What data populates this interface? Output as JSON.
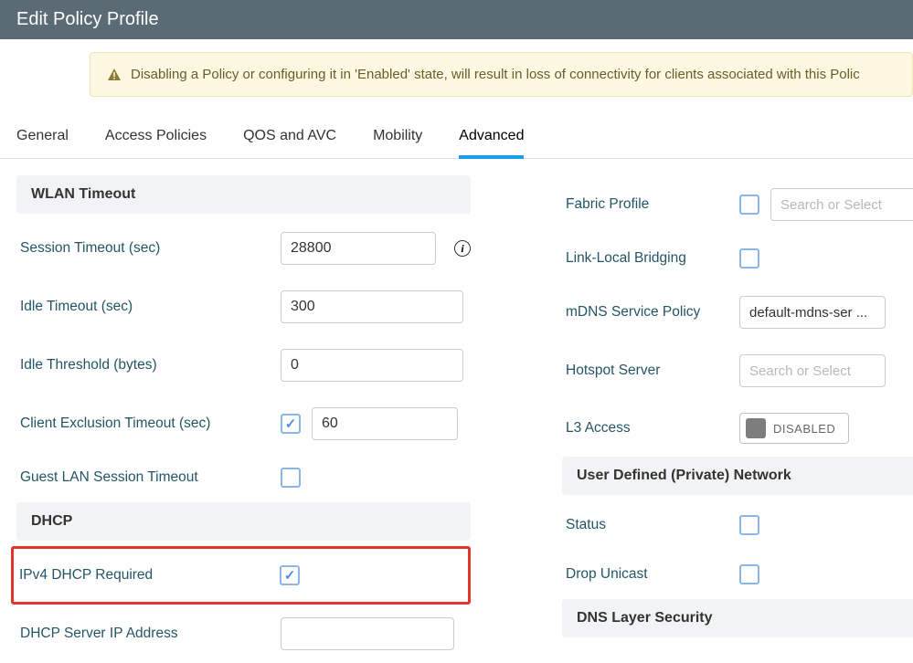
{
  "title": "Edit Policy Profile",
  "alert": "Disabling a Policy or configuring it in 'Enabled' state, will result in loss of connectivity for clients associated with this Polic",
  "tabs": [
    "General",
    "Access Policies",
    "QOS and AVC",
    "Mobility",
    "Advanced"
  ],
  "activeTab": 4,
  "sections": {
    "wlan_timeout": "WLAN Timeout",
    "dhcp": "DHCP",
    "udn": "User Defined (Private) Network",
    "dns": "DNS Layer Security"
  },
  "left": {
    "session_timeout_label": "Session Timeout (sec)",
    "session_timeout_value": "28800",
    "idle_timeout_label": "Idle Timeout (sec)",
    "idle_timeout_value": "300",
    "idle_threshold_label": "Idle Threshold (bytes)",
    "idle_threshold_value": "0",
    "client_excl_label": "Client Exclusion Timeout (sec)",
    "client_excl_value": "60",
    "guest_lan_label": "Guest LAN Session Timeout",
    "ipv4_dhcp_label": "IPv4 DHCP Required",
    "dhcp_server_label": "DHCP Server IP Address",
    "dhcp_server_value": ""
  },
  "right": {
    "fabric_label": "Fabric Profile",
    "fabric_placeholder": "Search or Select",
    "linklocal_label": "Link-Local Bridging",
    "mdns_label": "mDNS Service Policy",
    "mdns_value": "default-mdns-ser ...",
    "hotspot_label": "Hotspot Server",
    "hotspot_placeholder": "Search or Select",
    "l3_label": "L3 Access",
    "l3_state": "DISABLED",
    "status_label": "Status",
    "drop_unicast_label": "Drop Unicast"
  }
}
